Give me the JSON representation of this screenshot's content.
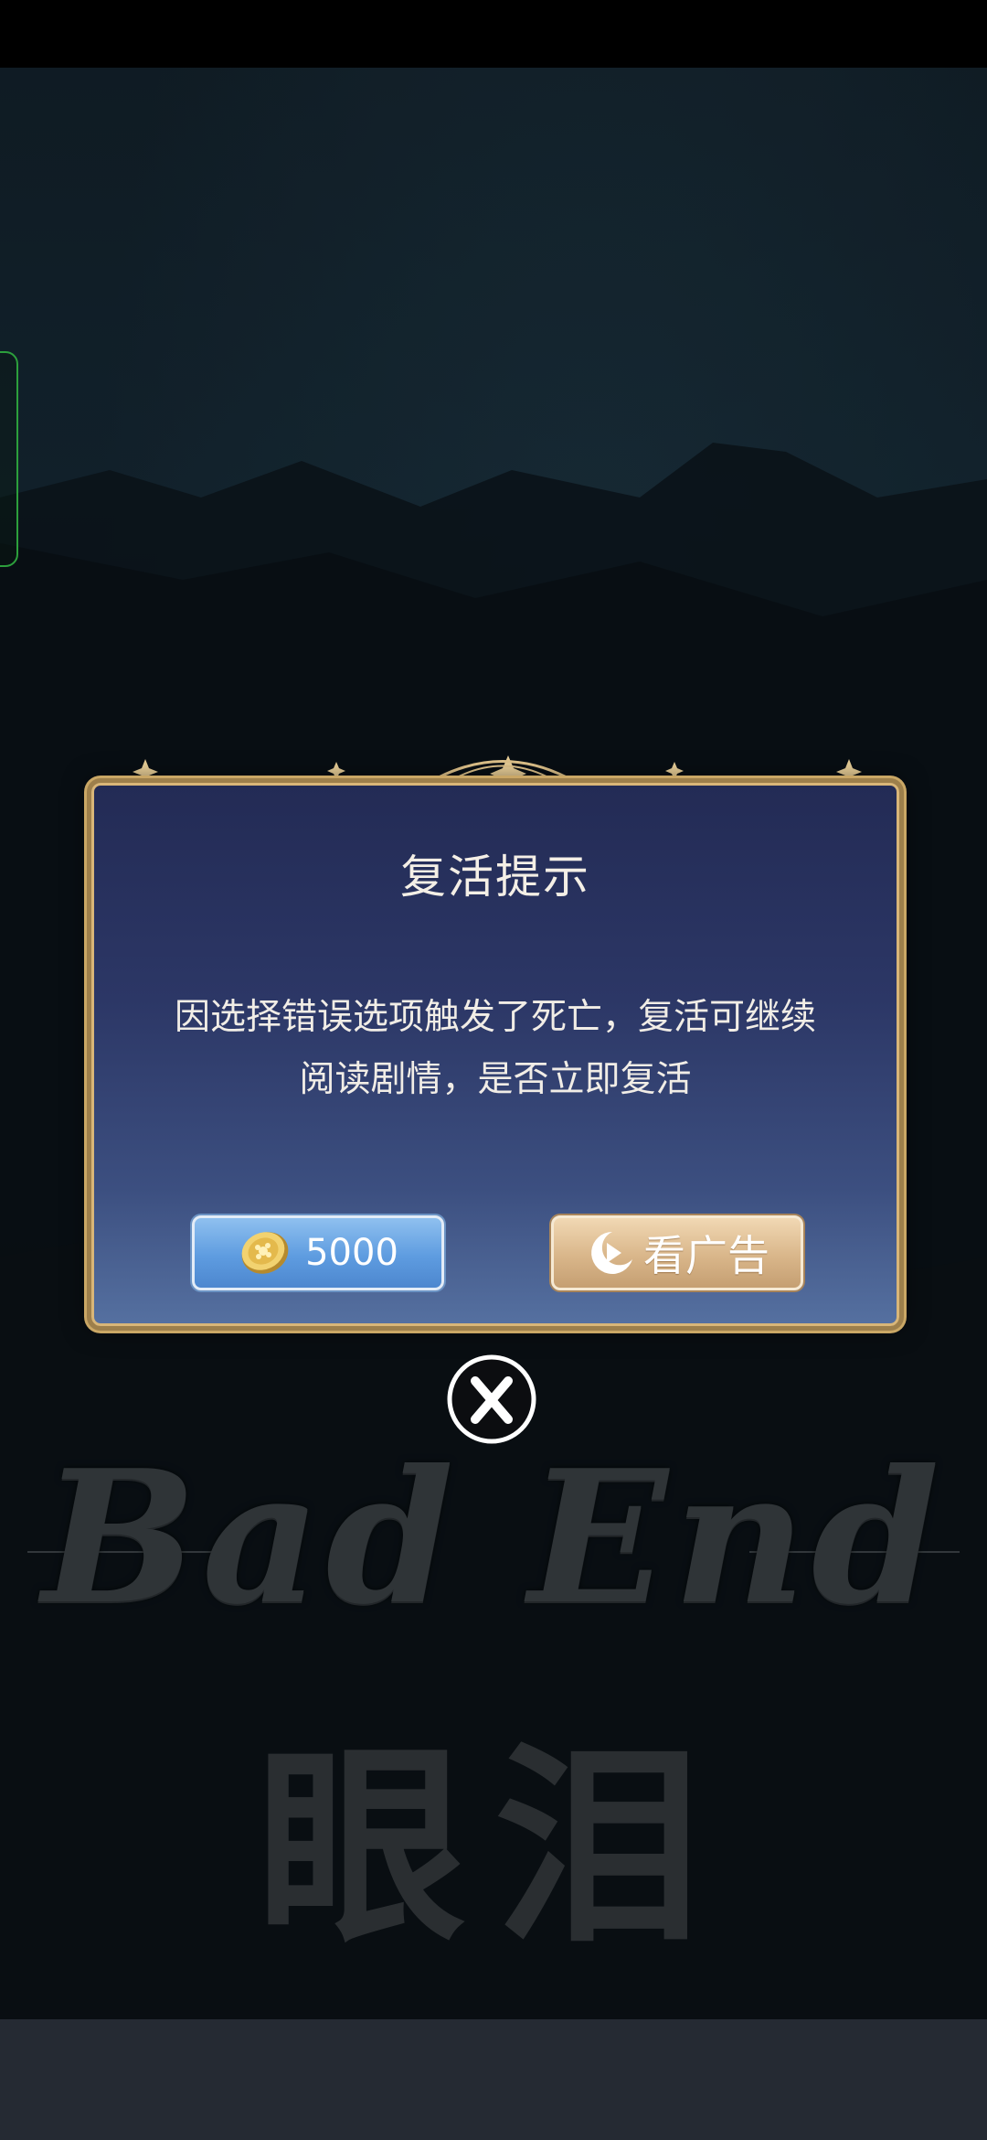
{
  "dialog": {
    "title": "复活提示",
    "message": "因选择错误选项触发了死亡，复活可继续阅读剧情，是否立即复活",
    "coin_button": {
      "amount": "5000",
      "icon": "coin-icon"
    },
    "ad_button": {
      "label": "看广告",
      "icon": "play-ad-icon"
    },
    "close_icon": "close-icon"
  },
  "background": {
    "title": "Bad End",
    "subtitle": "眼泪"
  },
  "colors": {
    "dialog_border": "#d9b678",
    "dialog_bg_top": "#232b55",
    "coin_button": "#5e9ce0",
    "ad_button": "#d9b68a",
    "side_tab_outline": "#36c24a"
  }
}
